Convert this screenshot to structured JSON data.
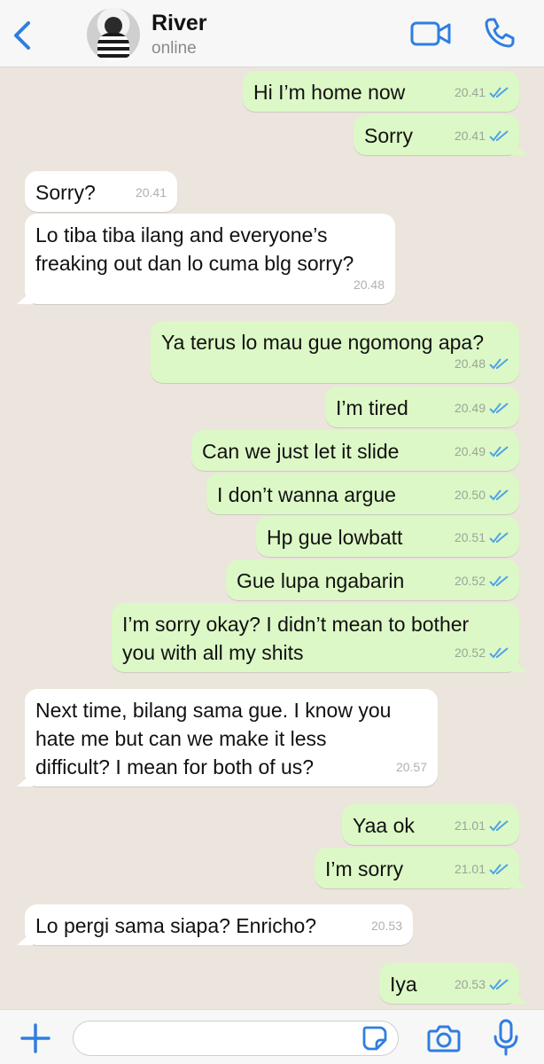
{
  "header": {
    "contact_name": "River",
    "contact_status": "online",
    "accent_color": "#2f7ee0"
  },
  "messages": [
    {
      "direction": "out",
      "text": "Hi I’m home now",
      "time": "20.41",
      "read": true
    },
    {
      "direction": "out",
      "text": "Sorry",
      "time": "20.41",
      "read": true
    },
    {
      "direction": "in",
      "text": "Sorry?",
      "time": "20.41"
    },
    {
      "direction": "in",
      "text": "Lo tiba tiba ilang and everyone’s\nfreaking out dan lo cuma blg sorry?",
      "time": "20.48"
    },
    {
      "direction": "out",
      "text": "Ya terus lo mau gue ngomong apa?",
      "time": "20.48",
      "read": true
    },
    {
      "direction": "out",
      "text": "I’m tired",
      "time": "20.49",
      "read": true
    },
    {
      "direction": "out",
      "text": "Can we just let it slide",
      "time": "20.49",
      "read": true
    },
    {
      "direction": "out",
      "text": "I don’t wanna argue",
      "time": "20.50",
      "read": true
    },
    {
      "direction": "out",
      "text": "Hp gue lowbatt",
      "time": "20.51",
      "read": true
    },
    {
      "direction": "out",
      "text": "Gue lupa ngabarin",
      "time": "20.52",
      "read": true
    },
    {
      "direction": "out",
      "text": "I’m sorry okay? I didn’t mean to bother\nyou with all my shits",
      "time": "20.52",
      "read": true
    },
    {
      "direction": "in",
      "text": "Next time, bilang sama gue. I know you\nhate me but can we make it less\ndifficult? I mean for both of us?",
      "time": "20.57"
    },
    {
      "direction": "out",
      "text": "Yaa ok",
      "time": "21.01",
      "read": true
    },
    {
      "direction": "out",
      "text": "I’m sorry",
      "time": "21.01",
      "read": true
    },
    {
      "direction": "in",
      "text": "Lo pergi sama siapa? Enricho?",
      "time": "20.53"
    },
    {
      "direction": "out",
      "text": "Iya",
      "time": "20.53",
      "read": true
    }
  ],
  "icons": {
    "back": "chevron-left-icon",
    "video": "video-camera-icon",
    "call": "phone-icon",
    "attach": "plus-icon",
    "sticker": "sticker-icon",
    "camera": "camera-icon",
    "mic": "microphone-icon",
    "read_receipt": "double-check-icon"
  },
  "colors": {
    "outgoing_bubble": "#dcf8c6",
    "incoming_bubble": "#ffffff",
    "chat_background": "#ece5dd",
    "read_receipt": "#4fa3e6"
  }
}
